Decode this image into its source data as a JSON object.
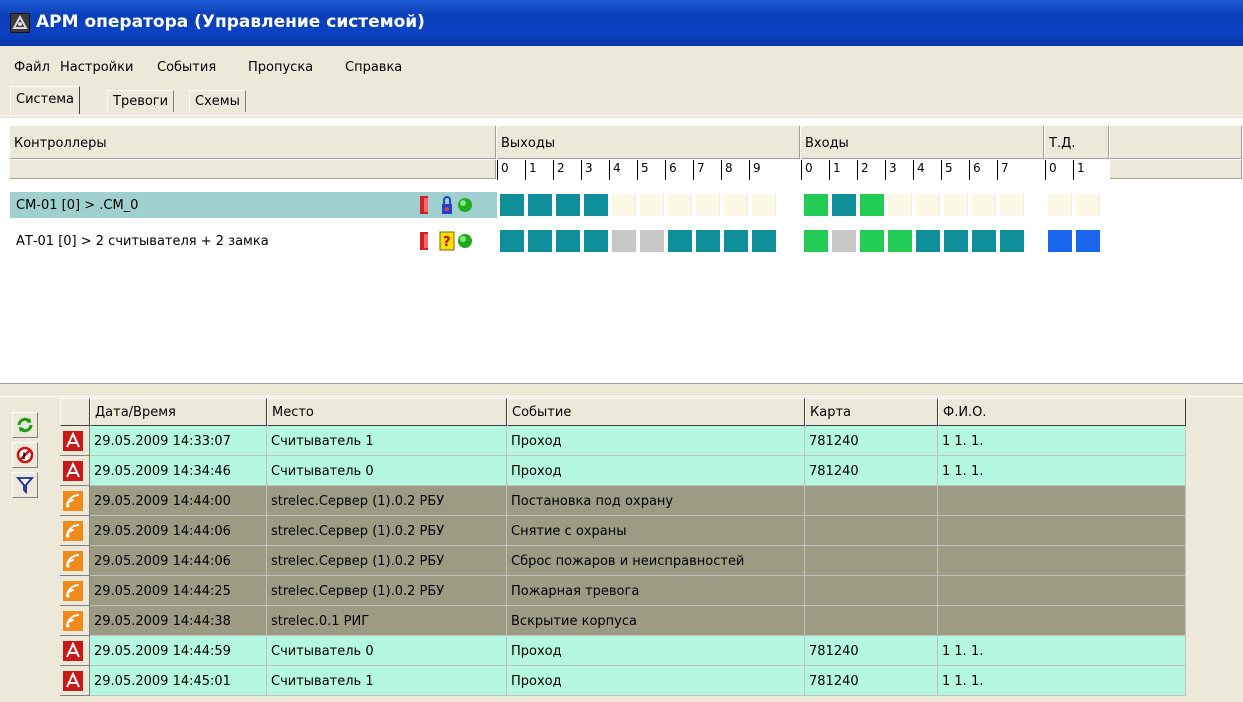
{
  "window": {
    "title": "АРМ оператора  (Управление системой)"
  },
  "menu": [
    "Файл",
    "Настройки",
    "События",
    "Пропуска",
    "Справка"
  ],
  "tabs": [
    "Система",
    "Тревоги",
    "Схемы"
  ],
  "controllers": {
    "header_label": "Контроллеры",
    "groups": [
      {
        "label": "Выходы",
        "numbers": [
          "0",
          "1",
          "2",
          "3",
          "4",
          "5",
          "6",
          "7",
          "8",
          "9"
        ]
      },
      {
        "label": "Входы",
        "numbers": [
          "0",
          "1",
          "2",
          "3",
          "4",
          "5",
          "6",
          "7"
        ]
      },
      {
        "label": "Т.Д.",
        "numbers": [
          "0",
          "1"
        ]
      }
    ],
    "rows": [
      {
        "name": "СМ-01 [0] > .CM_0",
        "selected": true,
        "outputs": [
          "teal",
          "teal",
          "teal",
          "teal",
          "empty",
          "empty",
          "empty",
          "empty",
          "empty",
          "empty"
        ],
        "inputs": [
          "green",
          "teal",
          "green",
          "empty",
          "empty",
          "empty",
          "empty",
          "empty"
        ],
        "td": [
          "empty",
          "empty"
        ]
      },
      {
        "name": "АТ-01 [0] > 2 считывателя + 2 замка",
        "selected": false,
        "outputs": [
          "teal",
          "teal",
          "teal",
          "teal",
          "gray",
          "gray",
          "teal",
          "teal",
          "teal",
          "teal"
        ],
        "inputs": [
          "green",
          "gray",
          "green",
          "green",
          "teal",
          "teal",
          "teal",
          "teal"
        ],
        "td": [
          "blue",
          "blue"
        ]
      }
    ]
  },
  "events": {
    "columns": [
      "Дата/Время",
      "Место",
      "Событие",
      "Карта",
      "Ф.И.О."
    ],
    "rows": [
      {
        "icon": "access-icon",
        "kind": "access",
        "datetime": "29.05.2009 14:33:07",
        "place": "Считыватель 1",
        "event": "Проход",
        "card": "781240",
        "name": "1 1. 1."
      },
      {
        "icon": "access-icon",
        "kind": "access",
        "datetime": "29.05.2009 14:34:46",
        "place": "Считыватель 0",
        "event": "Проход",
        "card": "781240",
        "name": "1 1. 1."
      },
      {
        "icon": "system-icon",
        "kind": "system",
        "datetime": "29.05.2009 14:44:00",
        "place": "strelec.Сервер (1).0.2 РБУ",
        "event": "Постановка под охрану",
        "card": "",
        "name": ""
      },
      {
        "icon": "system-icon",
        "kind": "system",
        "datetime": "29.05.2009 14:44:06",
        "place": "strelec.Сервер (1).0.2 РБУ",
        "event": "Снятие с охраны",
        "card": "",
        "name": ""
      },
      {
        "icon": "system-icon",
        "kind": "system",
        "datetime": "29.05.2009 14:44:06",
        "place": "strelec.Сервер (1).0.2 РБУ",
        "event": "Сброс пожаров и неисправностей",
        "card": "",
        "name": ""
      },
      {
        "icon": "system-icon",
        "kind": "system",
        "datetime": "29.05.2009 14:44:25",
        "place": "strelec.Сервер (1).0.2 РБУ",
        "event": "Пожарная тревога",
        "card": "",
        "name": ""
      },
      {
        "icon": "system-icon",
        "kind": "system",
        "datetime": "29.05.2009 14:44:38",
        "place": "strelec.0.1 РИГ",
        "event": "Вскрытие корпуса",
        "card": "",
        "name": ""
      },
      {
        "icon": "access-icon",
        "kind": "access",
        "datetime": "29.05.2009 14:44:59",
        "place": "Считыватель 0",
        "event": "Проход",
        "card": "781240",
        "name": "1 1. 1."
      },
      {
        "icon": "access-icon",
        "kind": "access",
        "datetime": "29.05.2009 14:45:01",
        "place": "Считыватель 1",
        "event": "Проход",
        "card": "781240",
        "name": "1 1. 1."
      }
    ]
  },
  "side_buttons": [
    "refresh-icon",
    "stop-icon",
    "filter-icon"
  ],
  "colors": {
    "teal": "#0f8f9a",
    "green": "#22cc55",
    "gray": "#c8c8c8",
    "blue": "#1a66ee",
    "empty": "#fbf8e6",
    "selected_row": "#9fcfcf",
    "access_row": "#b4f8e0",
    "system_row": "#9c9c84"
  }
}
